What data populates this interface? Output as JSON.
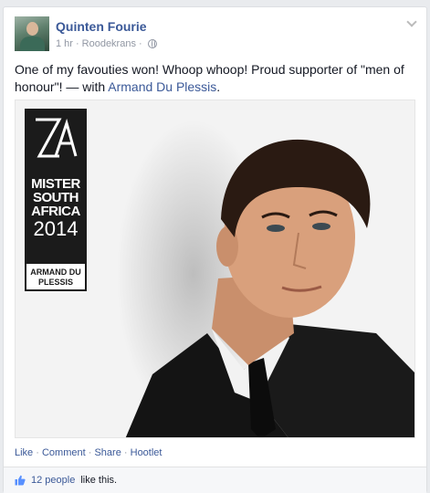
{
  "post": {
    "author": "Quinten Fourie",
    "time": "1 hr",
    "separator": "·",
    "location": "Roodekrans",
    "privacy_icon": "globe-icon",
    "text_main": "One of my favouties won! Whoop whoop! Proud supporter of \"men of honour\"! — with ",
    "tagged": "Armand Du Plessis",
    "text_end": "."
  },
  "photo": {
    "badge_line1": "MISTER SOUTH AFRICA",
    "badge_year": "2014",
    "badge_name": "ARMAND DU PLESSIS"
  },
  "actions": {
    "like": "Like",
    "comment": "Comment",
    "share": "Share",
    "hootlet": "Hootlet",
    "dot": "·"
  },
  "likes": {
    "count": "12 people",
    "suffix": "like this."
  },
  "colors": {
    "link": "#3b5998",
    "meta": "#9197a3",
    "background": "#e9ebee"
  }
}
